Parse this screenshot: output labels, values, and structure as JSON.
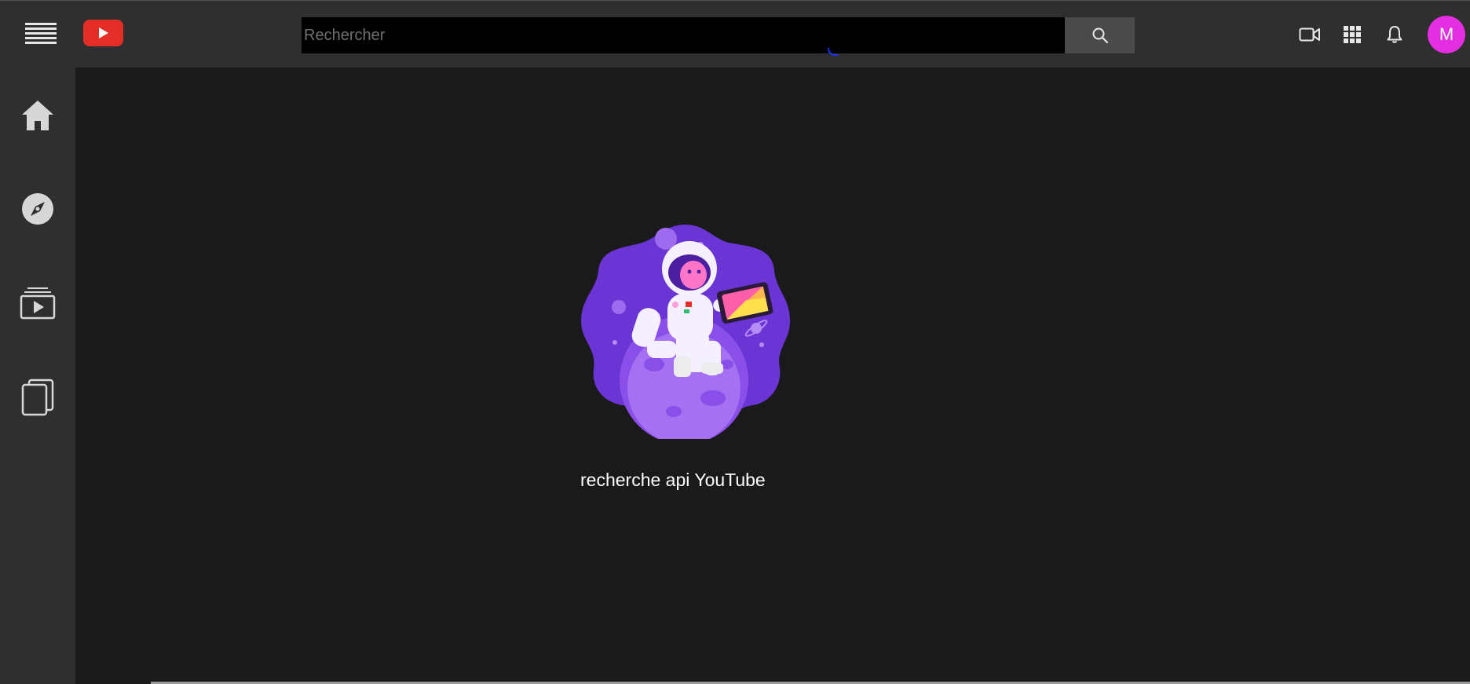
{
  "header": {
    "search": {
      "placeholder": "Rechercher",
      "value": ""
    },
    "avatar_letter": "M",
    "avatar_color": "#e32ee1",
    "icons": [
      "menu-icon",
      "youtube-logo",
      "search-icon",
      "video-camera-icon",
      "apps-grid-icon",
      "bell-icon"
    ]
  },
  "sidebar": {
    "items": [
      {
        "icon": "home-icon"
      },
      {
        "icon": "compass-icon"
      },
      {
        "icon": "subscriptions-icon"
      },
      {
        "icon": "library-icon"
      }
    ]
  },
  "main": {
    "caption": "recherche api YouTube"
  },
  "colors": {
    "topbar": "#2f2f2f",
    "background": "#1a1a1a",
    "brand_red": "#e52d27",
    "illustration_purple": "#6a35d4"
  }
}
